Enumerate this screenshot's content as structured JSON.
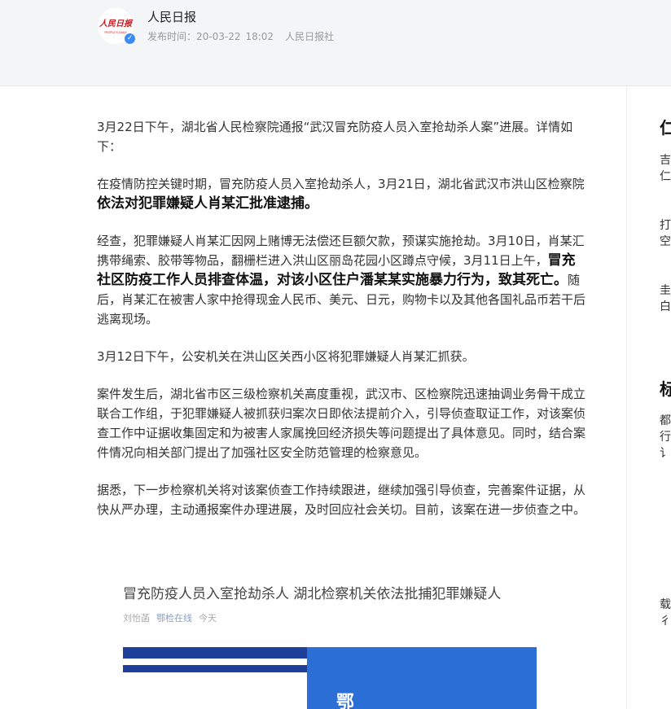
{
  "header": {
    "author": "人民日报",
    "publish_label": "发布时间：20-03-22",
    "publish_time": "18:02",
    "source": "人民日报社",
    "logo_text": "人民日报",
    "logo_subtext": "PEOPLE'S DAILY",
    "verified_icon": "✓"
  },
  "article": {
    "p1": "3月22日下午，湖北省人民检察院通报“武汉冒充防疫人员入室抢劫杀人案”进展。详情如下：",
    "p2_pre": "在疫情防控关键时期，冒充防疫人员入室抢劫杀人，3月21日，湖北省武汉市洪山区检察院",
    "p2_bold": "依法对犯罪嫌疑人肖某汇批准逮捕。",
    "p3_pre": "经查，犯罪嫌疑人肖某汇因网上赌博无法偿还巨额欠款，预谋实施抢劫。3月10日，肖某汇携带绳索、胶带等物品，翻栅栏进入洪山区丽岛花园小区蹲点守候，3月11日上午，",
    "p3_bold": "冒充社区防疫工作人员排查体温，对该小区住户潘某某实施暴力行为，致其死亡。",
    "p3_post": "随后，肖某汇在被害人家中抢得现金人民币、美元、日元，购物卡以及其他各国礼品币若干后逃离现场。",
    "p4": "3月12日下午，公安机关在洪山区关西小区将犯罪嫌疑人肖某汇抓获。",
    "p5": "案件发生后，湖北省市区三级检察机关高度重视，武汉市、区检察院迅速抽调业务骨干成立联合工作组，于犯罪嫌疑人被抓获归案次日即依法提前介入，引导侦查取证工作，对该案侦查工作中证据收集固定和为被害人家属挽回经济损失等问题提出了具体意见。同时，结合案件情况向相关部门提出了加强社区安全防范管理的检察意见。",
    "p6": "据悉，下一步检察机关将对该案侦查工作持续跟进，继续加强引导侦查，完善案件证据，从快从严办理，主动通报案件办理进展，及时回应社会关切。目前，该案在进一步侦查之中。"
  },
  "embed": {
    "title": "冒充防疫人员入室抢劫杀人 湖北检察机关依法批捕犯罪嫌疑人",
    "author": "刘怡菡",
    "source": "鄂检在线",
    "time": "今天",
    "banner_char": "鄂"
  },
  "sidebar": {
    "frags": [
      "仁",
      "吉",
      "仁",
      "打",
      "空",
      "圭",
      "白",
      "标",
      "都",
      "行",
      "讠",
      "载",
      "彳"
    ]
  },
  "colors": {
    "accent_blue": "#2b6fd6",
    "banner_navy": "#1e3f9a",
    "verified": "#3d8af7"
  }
}
